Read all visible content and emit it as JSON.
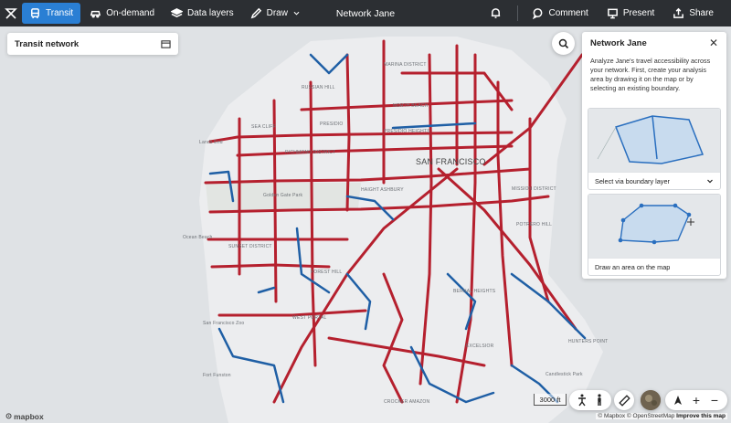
{
  "topbar": {
    "tabs": [
      {
        "label": "Transit",
        "icon": "bus-icon",
        "active": true
      },
      {
        "label": "On-demand",
        "icon": "car-icon",
        "active": false
      },
      {
        "label": "Data layers",
        "icon": "layers-icon",
        "active": false
      },
      {
        "label": "Draw",
        "icon": "pencil-icon",
        "active": false
      }
    ],
    "title": "Network Jane",
    "actions": [
      {
        "label": "Comment",
        "icon": "comment-icon"
      },
      {
        "label": "Present",
        "icon": "present-icon"
      },
      {
        "label": "Share",
        "icon": "share-icon"
      }
    ]
  },
  "left_card": {
    "title": "Transit network"
  },
  "panel": {
    "title": "Network Jane",
    "description": "Analyze Jane's travel accessibility across your network. First, create your analysis area by drawing it on the map or by selecting an existing boundary.",
    "options": [
      {
        "label": "Select via boundary layer"
      },
      {
        "label": "Draw an area on the map"
      }
    ]
  },
  "map": {
    "labels": [
      "SAN FRANCISCO",
      "MARINA DISTRICT",
      "RUSSIAN HILL",
      "NORTH BEACH",
      "PRESIDIO",
      "PRESIDIO HEIGHTS",
      "SEA CLIFF",
      "Lands End",
      "RICHMOND DISTRICT",
      "Golden Gate Park",
      "HAIGHT ASHBURY",
      "MISSION DISTRICT",
      "Ocean Beach",
      "SUNSET DISTRICT",
      "FOREST HILL",
      "BERNAL HEIGHTS",
      "EXCELSIOR",
      "CROCKER AMAZON",
      "San Francisco Zoo",
      "Fort Funston",
      "HUNTERS POINT",
      "Candlestick Park",
      "WEST PORTAL",
      "POTRERO HILL"
    ],
    "scale_label": "3000 ft",
    "brand": "mapbox",
    "attribution": "© Mapbox © OpenStreetMap",
    "attribution_link": "Improve this map"
  },
  "colors": {
    "accent": "#2a7fd4",
    "route_red": "#b5202e",
    "route_blue": "#1f5fa5",
    "topbar": "#2c2f33"
  }
}
